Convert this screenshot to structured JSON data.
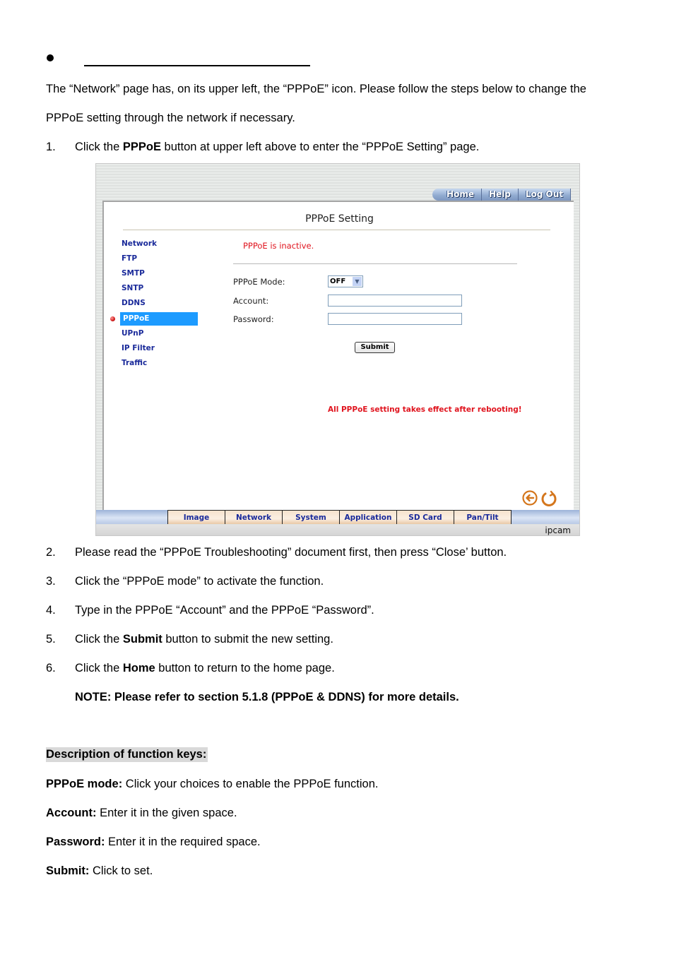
{
  "heading": {
    "title": ""
  },
  "intro": {
    "line1": "The “Network” page has, on its upper left, the “PPPoE” icon. Please follow the steps below to change the",
    "line2": "PPPoE setting through the network if necessary."
  },
  "steps": [
    {
      "num": "1.",
      "pre": "Click the ",
      "bold": "PPPoE",
      "post": " button at upper left above to enter the “PPPoE Setting” page."
    },
    {
      "num": "2.",
      "pre": "Please read the “PPPoE Troubleshooting” document first, then press “Close’ button.",
      "bold": "",
      "post": ""
    },
    {
      "num": "3.",
      "pre": "Click the “PPPoE mode” to activate the function.",
      "bold": "",
      "post": ""
    },
    {
      "num": "4.",
      "pre": "Type in the PPPoE “Account” and the PPPoE “Password”.",
      "bold": "",
      "post": ""
    },
    {
      "num": "5.",
      "pre": "Click the ",
      "bold": "Submit",
      "post": " button to submit the new setting."
    },
    {
      "num": "6.",
      "pre": "Click the ",
      "bold": "Home",
      "post": " button to return to the home page."
    }
  ],
  "note": "NOTE: Please refer to section 5.1.8 (PPPoE & DDNS) for more details.",
  "screenshot": {
    "top_nav": [
      "Home",
      "Help",
      "Log Out"
    ],
    "title": "PPPoE Setting",
    "menu": [
      "Network",
      "FTP",
      "SMTP",
      "SNTP",
      "DDNS",
      "PPPoE",
      "UPnP",
      "IP Filter",
      "Traffic"
    ],
    "active_menu": "PPPoE",
    "status": "PPPoE is inactive.",
    "fields": {
      "mode_label": "PPPoE Mode:",
      "mode_value": "OFF",
      "account_label": "Account:",
      "account_value": "",
      "password_label": "Password:",
      "password_value": ""
    },
    "submit": "Submit",
    "warning": "All PPPoE setting takes effect after rebooting!",
    "icons": [
      "back-arrow-icon",
      "refresh-icon"
    ],
    "bottom_tabs": [
      "Image",
      "Network",
      "System",
      "Application",
      "SD Card",
      "Pan/Tilt"
    ],
    "footer": "ipcam",
    "colors": {
      "status_red": "#e0141e",
      "menu_blue": "#1a2a9a",
      "active_bg": "#1d9bff",
      "icon_orange": "#d4761c"
    }
  },
  "description": {
    "heading": "Description of function keys:",
    "items": [
      {
        "key": "PPPoE mode:",
        "text": " Click your choices to enable the PPPoE function."
      },
      {
        "key": "Account:",
        "text": " Enter it in the given space."
      },
      {
        "key": "Password:",
        "text": " Enter it in the required space."
      },
      {
        "key": "Submit:",
        "text": " Click to set."
      }
    ]
  }
}
